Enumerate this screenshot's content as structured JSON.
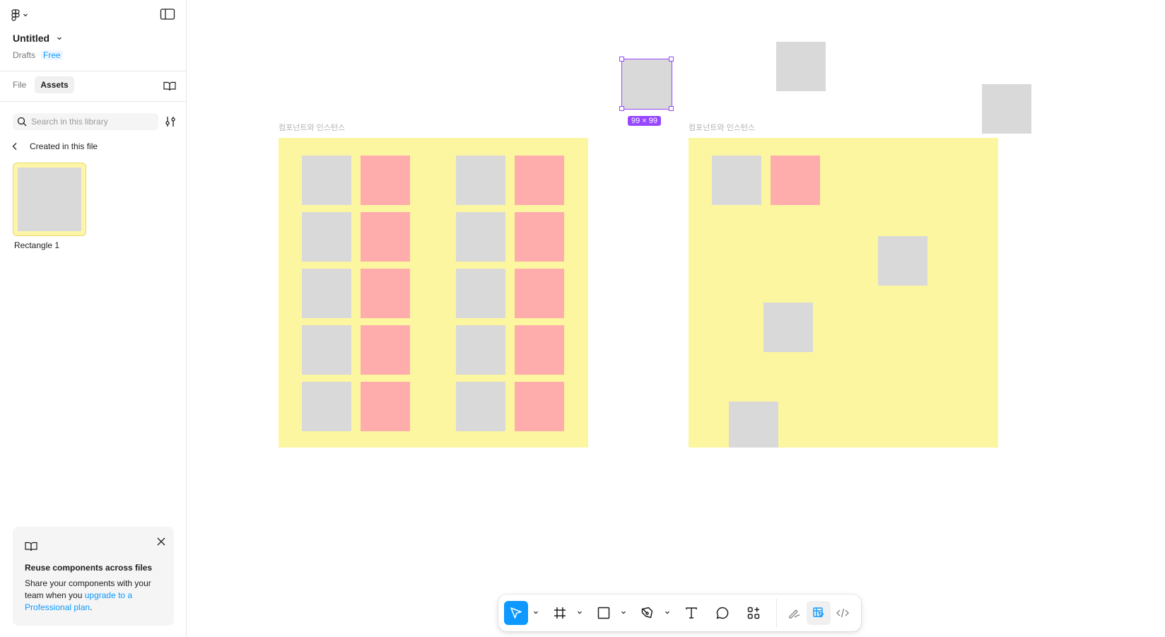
{
  "sidebar": {
    "file_name": "Untitled",
    "location": "Drafts",
    "plan_badge": "Free",
    "tabs": [
      {
        "label": "File",
        "active": false
      },
      {
        "label": "Assets",
        "active": true
      }
    ],
    "search": {
      "placeholder": "Search in this library",
      "value": ""
    },
    "back_label": "Created in this file",
    "assets": [
      {
        "label": "Rectangle 1"
      }
    ],
    "promo": {
      "title": "Reuse components across files",
      "body_prefix": "Share your components with your team when you ",
      "link_text": "upgrade to a Professional plan",
      "body_suffix": "."
    }
  },
  "canvas": {
    "frames": [
      {
        "label": "컴포넌트와 인스턴스"
      },
      {
        "label": "컴포넌트와 인스턴스"
      }
    ],
    "selection_size": "99 × 99"
  },
  "toolbar": {
    "tools": [
      {
        "icon": "move-cursor-icon",
        "active": true
      },
      {
        "icon": "frame-icon"
      },
      {
        "icon": "rectangle-icon"
      },
      {
        "icon": "pen-icon"
      },
      {
        "icon": "text-icon"
      },
      {
        "icon": "comment-icon"
      },
      {
        "icon": "actions-icon"
      },
      {
        "icon": "draw-mode-icon"
      },
      {
        "icon": "design-mode-icon",
        "active": true
      },
      {
        "icon": "dev-mode-icon"
      }
    ]
  },
  "colors": {
    "accent": "#0d99ff",
    "selection": "#9747ff",
    "frame_fill": "#fdf6a0",
    "rect_gray": "#d9d9d9",
    "rect_pink": "#ffacad"
  }
}
